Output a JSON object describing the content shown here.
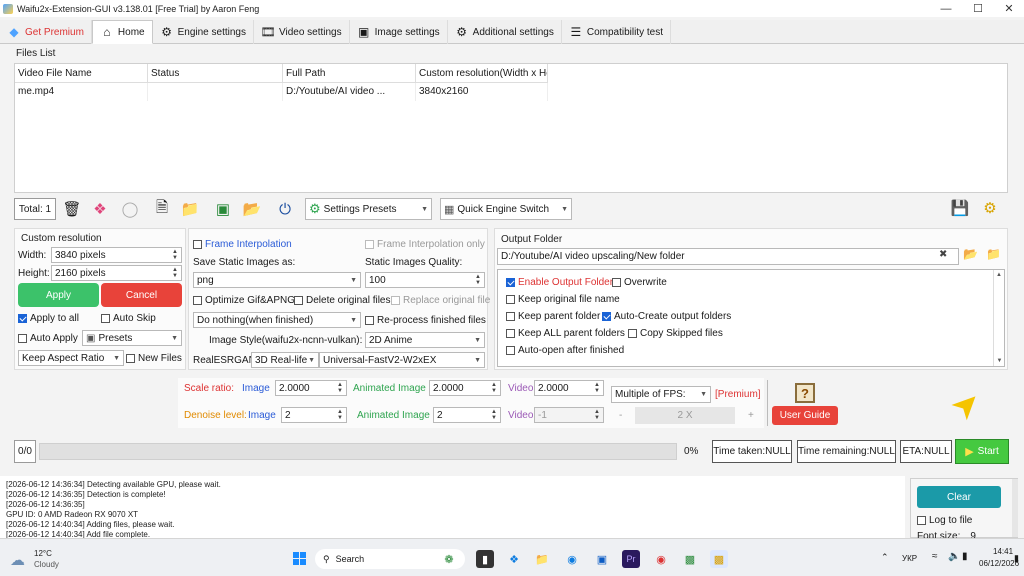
{
  "window": {
    "title": "Waifu2x-Extension-GUI v3.138.01 [Free Trial] by Aaron Feng"
  },
  "tabs": [
    {
      "label": "Get Premium",
      "icon": "diamond-icon"
    },
    {
      "label": "Home",
      "icon": "home-icon"
    },
    {
      "label": "Engine settings",
      "icon": "engine-icon"
    },
    {
      "label": "Video settings",
      "icon": "film-icon"
    },
    {
      "label": "Image settings",
      "icon": "image-icon"
    },
    {
      "label": "Additional settings",
      "icon": "gear-icon"
    },
    {
      "label": "Compatibility test",
      "icon": "list-icon"
    }
  ],
  "files_list": {
    "group_label": "Files List",
    "columns": [
      "Video File Name",
      "Status",
      "Full Path",
      "Custom resolution(Width x He"
    ],
    "rows": [
      [
        "me.mp4",
        "",
        "D:/Youtube/AI video ...",
        "3840x2160"
      ]
    ]
  },
  "toolbar": {
    "total": "Total: 1",
    "settings_presets": "Settings Presets",
    "quick_engine_switch": "Quick Engine Switch"
  },
  "custom_resolution": {
    "label": "Custom resolution",
    "width_label": "Width:",
    "width_value": "3840 pixels",
    "height_label": "Height:",
    "height_value": "2160 pixels",
    "apply": "Apply",
    "cancel": "Cancel",
    "apply_to_all": "Apply to all",
    "auto_skip": "Auto Skip",
    "auto_apply": "Auto Apply",
    "presets": "Presets",
    "keep_aspect": "Keep Aspect Ratio",
    "new_files": "New Files"
  },
  "middle": {
    "frame_interpolation": "Frame Interpolation",
    "frame_interpolation_only": "Frame Interpolation only",
    "save_static_label": "Save Static Images as:",
    "save_static_value": "png",
    "static_quality_label": "Static Images Quality:",
    "static_quality_value": "100",
    "optimize_gif": "Optimize Gif&APNG",
    "delete_original": "Delete original files",
    "replace_original": "Replace original file",
    "after_finish": "Do nothing(when finished)",
    "reprocess": "Re-process finished files",
    "image_style_label": "Image Style(waifu2x-ncnn-vulkan):",
    "image_style_value": "2D Anime",
    "realesrgan_label": "RealESRGAN:",
    "realesrgan_value": "3D Real-life",
    "model_value": "Universal-FastV2-W2xEX"
  },
  "output": {
    "label": "Output Folder",
    "path": "D:/Youtube/AI video upscaling/New folder",
    "enable_output_folder": "Enable Output Folder",
    "overwrite": "Overwrite",
    "keep_original_name": "Keep original file name",
    "keep_parent_folder": "Keep parent folder",
    "auto_create": "Auto-Create output folders",
    "keep_all_parent": "Keep ALL parent folders",
    "copy_skipped": "Copy Skipped files",
    "auto_open": "Auto-open after finished"
  },
  "scale": {
    "scale_ratio_label": "Scale ratio:",
    "image_label": "Image",
    "image_value": "2.0000",
    "animated_label": "Animated Image",
    "animated_value": "2.0000",
    "video_label": "Video",
    "video_value": "2.0000",
    "denoise_label": "Denoise level:",
    "denoise_image_value": "2",
    "denoise_animated_value": "2",
    "denoise_video_value": "-1",
    "fps_combo": "Multiple of FPS:",
    "premium_tag": "[Premium]",
    "fps_minus": "-",
    "fps_value": "2 X",
    "fps_plus": "+",
    "user_guide": "User Guide"
  },
  "progress": {
    "count": "0/0",
    "percent": "0%",
    "fill_fraction": 0.0,
    "time_taken": "Time taken:NULL",
    "time_remaining": "Time remaining:NULL",
    "eta": "ETA:NULL",
    "start": "Start"
  },
  "log_lines": [
    "[2026-06-12 14:36:34] Detecting available GPU, please wait.",
    "[2026-06-12 14:36:35] Detection is complete!",
    "[2026-06-12 14:36:35]",
    "GPU ID: 0 AMD Radeon RX 9070 XT",
    "[2026-06-12 14:40:34] Adding files, please wait.",
    "[2026-06-12 14:40:34] Add file complete."
  ],
  "side": {
    "clear": "Clear",
    "log_to_file": "Log to file",
    "font_size_label": "Font size:",
    "font_size_value": "9"
  },
  "taskbar": {
    "temperature": "12°C",
    "weather": "Cloudy",
    "search": "Search",
    "language": "УКР",
    "time": "14:41",
    "date": "06/12/2026"
  },
  "colors": {
    "apply_green": "#3cc26a",
    "cancel_red": "#e8433a",
    "start_green": "#45c940",
    "clear_teal": "#1b9aa8",
    "user_guide_red": "#e8433a"
  }
}
